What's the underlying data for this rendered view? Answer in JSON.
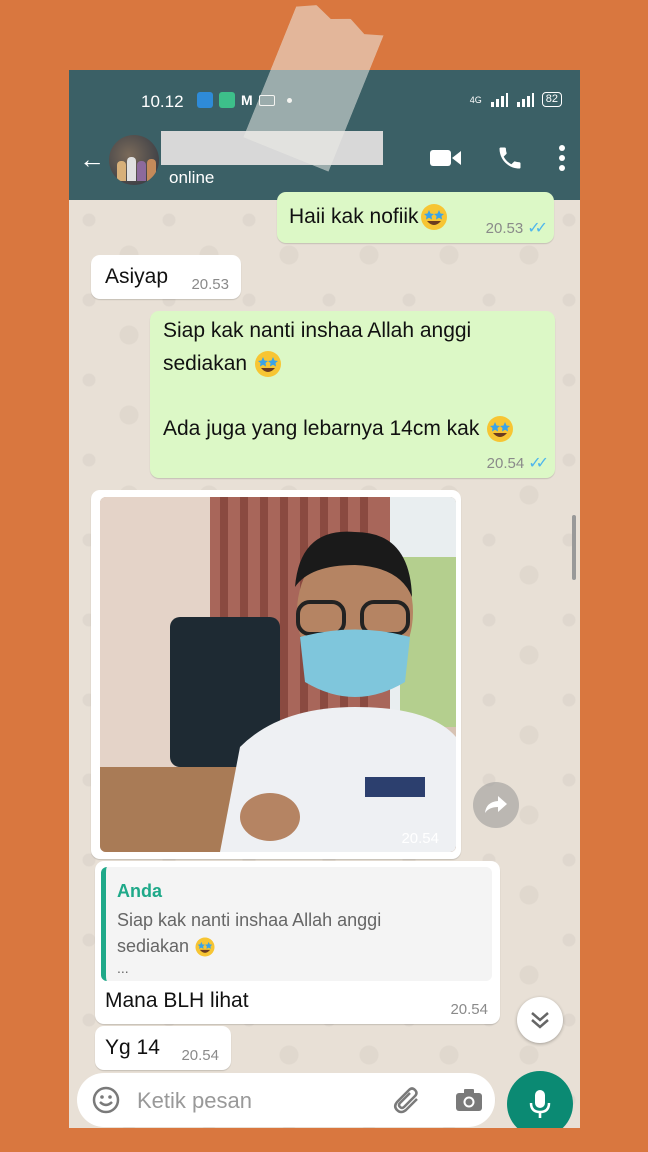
{
  "statusbar": {
    "time": "10.12",
    "battery": "82",
    "network": "4G"
  },
  "header": {
    "status": "online"
  },
  "messages": [
    {
      "dir": "out",
      "text": "Haii kak nofiik",
      "time": "20.53"
    },
    {
      "dir": "in",
      "text": "Asiyap",
      "time": "20.53"
    },
    {
      "dir": "out",
      "line1": "Siap kak nanti inshaa Allah anggi",
      "line2": "sediakan",
      "line3": "Ada juga yang lebarnya 14cm kak",
      "time": "20.54"
    },
    {
      "dir": "in",
      "type": "image",
      "time": "20.54"
    },
    {
      "dir": "in",
      "quote_author": "Anda",
      "quote_line1": "Siap kak nanti inshaa Allah anggi",
      "quote_line2": "sediakan",
      "quote_more": "...",
      "text": "Mana BLH lihat",
      "time": "20.54"
    },
    {
      "dir": "in",
      "text": "Yg 14",
      "time": "20.54"
    }
  ],
  "composer": {
    "placeholder": "Ketik pesan"
  },
  "colors": {
    "header": "#3b6066",
    "outgoing": "#dcf8c6",
    "accent": "#0b8a73",
    "background": "#d9773f"
  }
}
